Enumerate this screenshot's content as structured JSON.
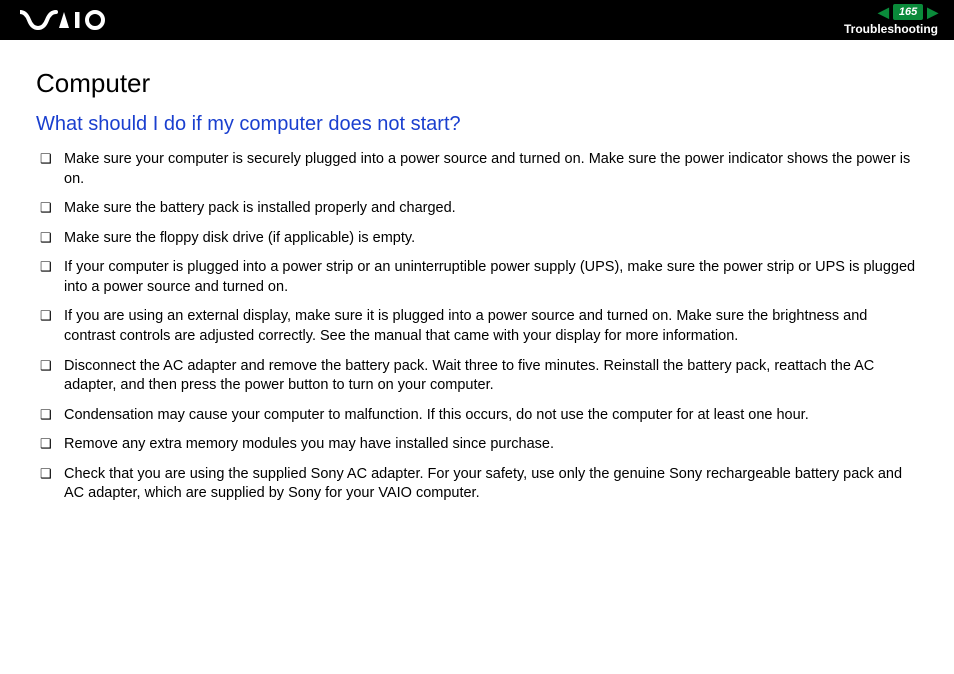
{
  "header": {
    "page_number": "165",
    "section": "Troubleshooting"
  },
  "content": {
    "title": "Computer",
    "question": "What should I do if my computer does not start?",
    "bullets": [
      "Make sure your computer is securely plugged into a power source and turned on. Make sure the power indicator shows the power is on.",
      "Make sure the battery pack is installed properly and charged.",
      "Make sure the floppy disk drive (if applicable) is empty.",
      "If your computer is plugged into a power strip or an uninterruptible power supply (UPS), make sure the power strip or UPS is plugged into a power source and turned on.",
      "If you are using an external display, make sure it is plugged into a power source and turned on. Make sure the brightness and contrast controls are adjusted correctly. See the manual that came with your display for more information.",
      "Disconnect the AC adapter and remove the battery pack. Wait three to five minutes. Reinstall the battery pack, reattach the AC adapter, and then press the power button to turn on your computer.",
      "Condensation may cause your computer to malfunction. If this occurs, do not use the computer for at least one hour.",
      "Remove any extra memory modules you may have installed since purchase.",
      "Check that you are using the supplied Sony AC adapter. For your safety, use only the genuine Sony rechargeable battery pack and AC adapter, which are supplied by Sony for your VAIO computer."
    ]
  }
}
